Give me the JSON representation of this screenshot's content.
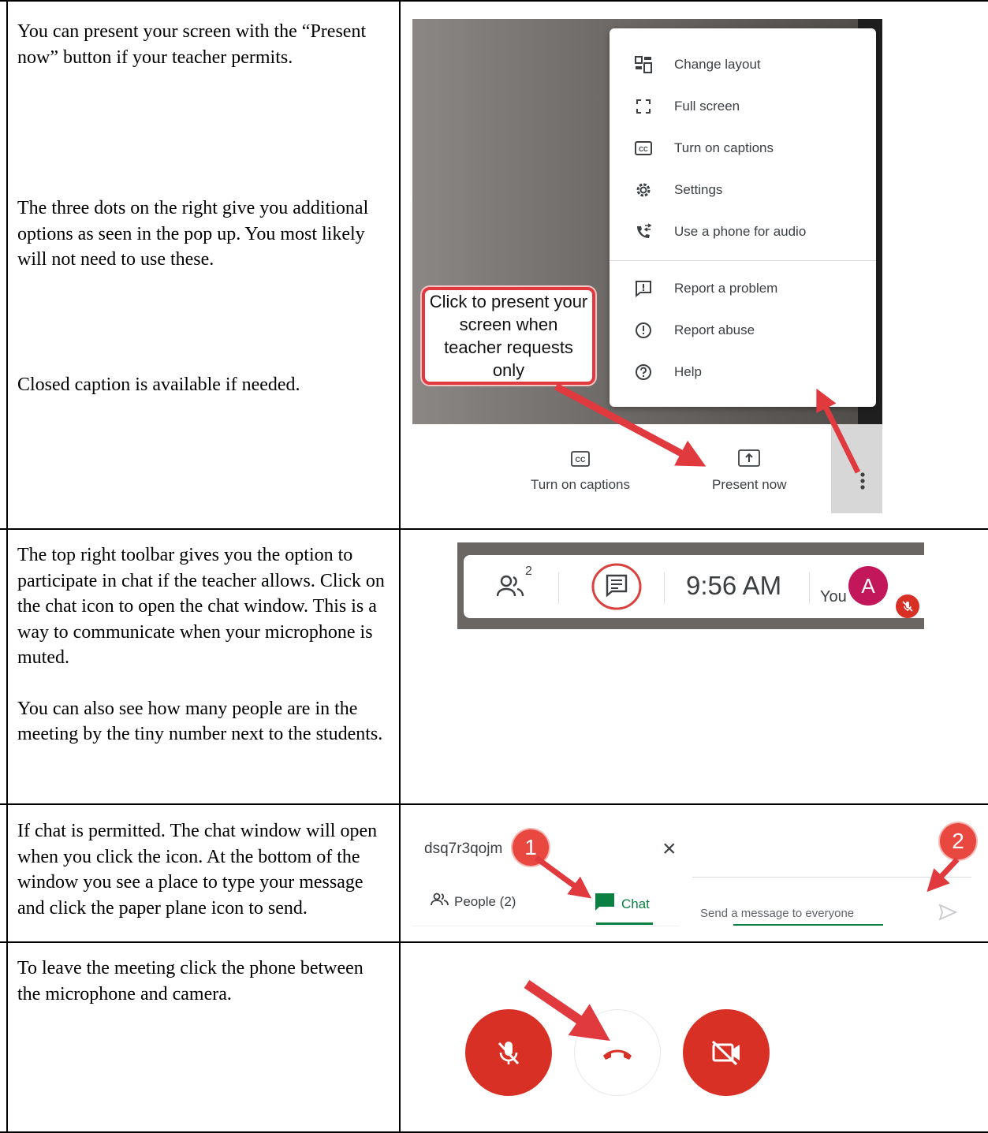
{
  "rows": [
    {
      "paragraphs": [
        "You can present your screen with the “Present now” button if your teacher permits.",
        "The three dots on the right give you additional options as seen in the pop up. You most likely will not need to use these.",
        "Closed caption is available if needed."
      ],
      "screenshot": {
        "menu": {
          "items": [
            {
              "label": "Change layout",
              "icon": "layout-icon"
            },
            {
              "label": "Full screen",
              "icon": "fullscreen-icon"
            },
            {
              "label": "Turn on captions",
              "icon": "captions-icon"
            },
            {
              "label": "Settings",
              "icon": "gear-icon"
            },
            {
              "label": "Use a phone for audio",
              "icon": "phone-audio-icon"
            },
            {
              "label": "Report a problem",
              "icon": "report-problem-icon"
            },
            {
              "label": "Report abuse",
              "icon": "report-abuse-icon"
            },
            {
              "label": "Help",
              "icon": "help-icon"
            }
          ]
        },
        "callout": "Click to present your screen when teacher requests only",
        "bottom_bar": {
          "captions_label": "Turn on captions",
          "present_label": "Present now"
        },
        "colors": {
          "callout_border": "#e0393e",
          "arrow": "#e0393e"
        }
      }
    },
    {
      "paragraphs": [
        "The top right toolbar gives you the option to participate in chat if the teacher allows. Click on the chat icon to open the chat window. This is a way to communicate when your microphone is muted.",
        "You can also see how many people are in the meeting by the tiny number next to the students."
      ],
      "screenshot": {
        "people_count": "2",
        "time": "9:56 AM",
        "you_label": "You",
        "avatar_letter": "A",
        "colors": {
          "avatar": "#c2185b",
          "mute": "#d93025"
        }
      }
    },
    {
      "paragraphs": [
        "If chat is permitted.  The chat window will open when you click the icon.  At the bottom of the window you see a place to type your message and click the paper plane icon to send."
      ],
      "screenshot": {
        "meeting_code": "dsq7r3qojm",
        "close_symbol": "×",
        "people_tab": "People (2)",
        "chat_tab": "Chat",
        "message_placeholder": "Send a message to everyone",
        "badge_1": "1",
        "badge_2": "2",
        "colors": {
          "chat_green": "#0b8043",
          "badge": "#e8483f"
        }
      }
    },
    {
      "paragraphs": [
        "To leave the meeting click the phone between the microphone and camera."
      ],
      "screenshot": {
        "colors": {
          "button_red": "#d93025",
          "hangup_icon": "#d93025"
        }
      }
    }
  ]
}
